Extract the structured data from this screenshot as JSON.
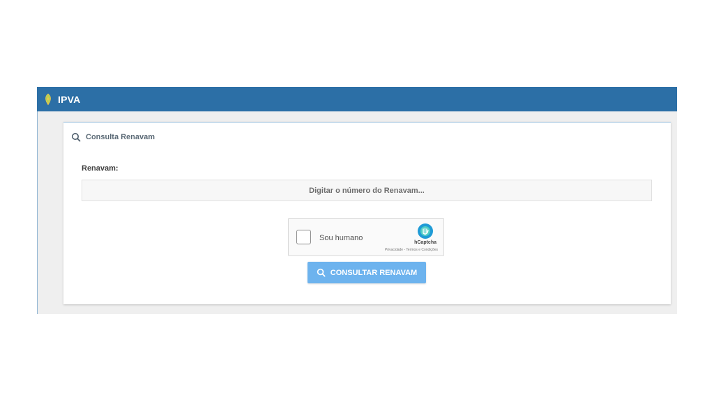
{
  "header": {
    "title": "IPVA",
    "bar_color": "#2c6fa6",
    "logo_icon": "leaf-emblem-icon"
  },
  "card": {
    "title": "Consulta Renavam",
    "title_icon": "search-icon"
  },
  "form": {
    "renavam_label": "Renavam:",
    "renavam_value": "",
    "renavam_placeholder": "Digitar o número do Renavam..."
  },
  "captcha": {
    "checkbox_label": "Sou humano",
    "checked": false,
    "brand": "hCaptcha",
    "links": "Privacidade - Termos e Condições"
  },
  "submit": {
    "label": "CONSULTAR RENAVAM",
    "icon": "search-icon",
    "color": "#6db3ee"
  }
}
